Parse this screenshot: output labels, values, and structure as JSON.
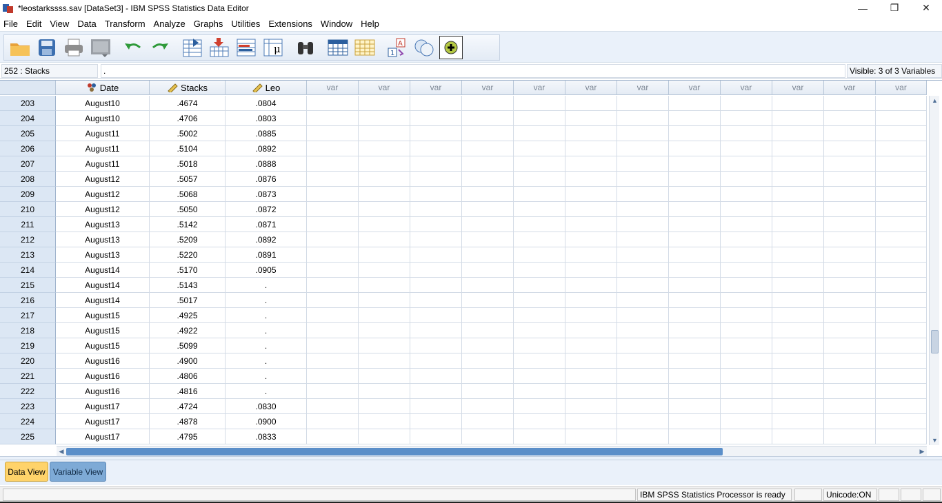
{
  "window": {
    "title": "*leostarkssss.sav [DataSet3] - IBM SPSS Statistics Data Editor",
    "minimize": "—",
    "maximize": "❐",
    "close": "✕"
  },
  "menu": [
    "File",
    "Edit",
    "View",
    "Data",
    "Transform",
    "Analyze",
    "Graphs",
    "Utilities",
    "Extensions",
    "Window",
    "Help"
  ],
  "toolbar": {
    "icons": [
      "open-folder",
      "save",
      "print",
      "dialog-recall",
      "undo",
      "redo",
      "goto-case",
      "goto-variable",
      "variables",
      "descriptive",
      "find",
      "insert-cases",
      "insert-variable",
      "split-file",
      "weight-cases",
      "select-cases",
      "value-labels",
      "use-sets"
    ]
  },
  "cell_editor": {
    "reference": "252 : Stacks",
    "value": ".",
    "visible": "Visible: 3 of 3 Variables"
  },
  "grid": {
    "columns": [
      {
        "name": "Date",
        "icon": "nominal-icon"
      },
      {
        "name": "Stacks",
        "icon": "scale-icon"
      },
      {
        "name": "Leo",
        "icon": "scale-icon"
      }
    ],
    "empty_column_label": "var",
    "rows": [
      {
        "n": "203",
        "date": "August10",
        "stacks": ".4674",
        "leo": ".0804"
      },
      {
        "n": "204",
        "date": "August10",
        "stacks": ".4706",
        "leo": ".0803"
      },
      {
        "n": "205",
        "date": "August11",
        "stacks": ".5002",
        "leo": ".0885"
      },
      {
        "n": "206",
        "date": "August11",
        "stacks": ".5104",
        "leo": ".0892"
      },
      {
        "n": "207",
        "date": "August11",
        "stacks": ".5018",
        "leo": ".0888"
      },
      {
        "n": "208",
        "date": "August12",
        "stacks": ".5057",
        "leo": ".0876"
      },
      {
        "n": "209",
        "date": "August12",
        "stacks": ".5068",
        "leo": ".0873"
      },
      {
        "n": "210",
        "date": "August12",
        "stacks": ".5050",
        "leo": ".0872"
      },
      {
        "n": "211",
        "date": "August13",
        "stacks": ".5142",
        "leo": ".0871"
      },
      {
        "n": "212",
        "date": "August13",
        "stacks": ".5209",
        "leo": ".0892"
      },
      {
        "n": "213",
        "date": "August13",
        "stacks": ".5220",
        "leo": ".0891"
      },
      {
        "n": "214",
        "date": "August14",
        "stacks": ".5170",
        "leo": ".0905"
      },
      {
        "n": "215",
        "date": "August14",
        "stacks": ".5143",
        "leo": "."
      },
      {
        "n": "216",
        "date": "August14",
        "stacks": ".5017",
        "leo": "."
      },
      {
        "n": "217",
        "date": "August15",
        "stacks": ".4925",
        "leo": "."
      },
      {
        "n": "218",
        "date": "August15",
        "stacks": ".4922",
        "leo": "."
      },
      {
        "n": "219",
        "date": "August15",
        "stacks": ".5099",
        "leo": "."
      },
      {
        "n": "220",
        "date": "August16",
        "stacks": ".4900",
        "leo": "."
      },
      {
        "n": "221",
        "date": "August16",
        "stacks": ".4806",
        "leo": "."
      },
      {
        "n": "222",
        "date": "August16",
        "stacks": ".4816",
        "leo": "."
      },
      {
        "n": "223",
        "date": "August17",
        "stacks": ".4724",
        "leo": ".0830"
      },
      {
        "n": "224",
        "date": "August17",
        "stacks": ".4878",
        "leo": ".0900"
      },
      {
        "n": "225",
        "date": "August17",
        "stacks": ".4795",
        "leo": ".0833"
      }
    ]
  },
  "tabs": {
    "data_view": "Data View",
    "variable_view": "Variable View"
  },
  "status": {
    "processor": "IBM SPSS Statistics Processor is ready",
    "unicode": "Unicode:ON"
  },
  "colors": {
    "active_tab": "#ffd36a",
    "inactive_tab": "#7eaad6",
    "row_header": "#dce7f4"
  }
}
